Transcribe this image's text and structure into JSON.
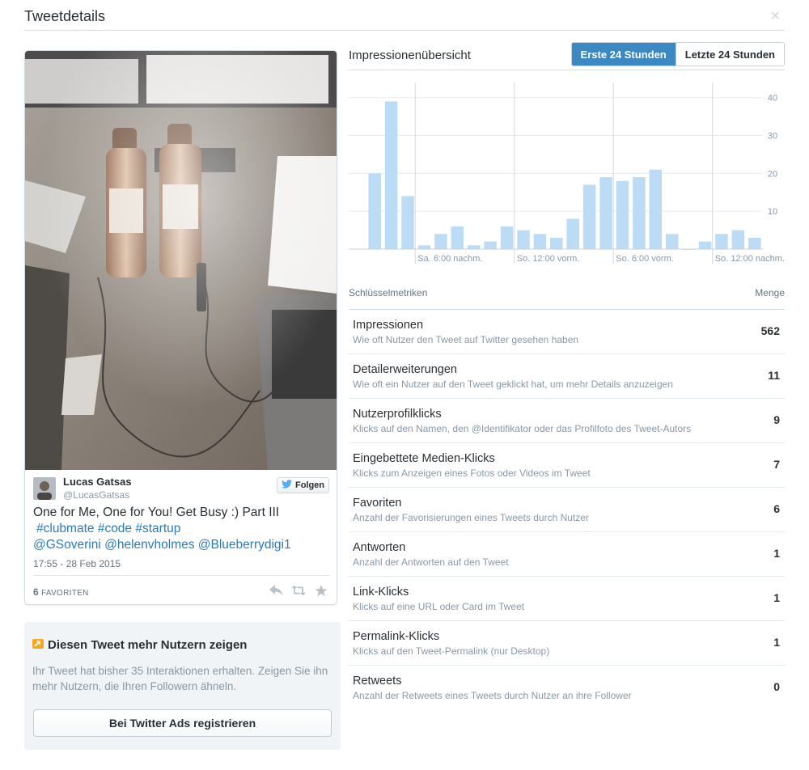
{
  "header": {
    "title": "Tweetdetails",
    "close_glyph": "×"
  },
  "tweet": {
    "author_name": "Lucas Gatsas",
    "author_handle": "@LucasGatsas",
    "follow_label": "Folgen",
    "text_plain": "One for Me, One for You! Get Busy :) Part III",
    "hashtags": "#clubmate #code #startup",
    "mentions": "@GSoverini @helenvholmes @Blueberrydigi1",
    "timestamp": "17:55 - 28 Feb 2015",
    "fav_count": "6",
    "fav_label": "FAVORITEN",
    "link_color": "#2b7bb9"
  },
  "promo": {
    "title": "Diesen Tweet mehr Nutzern zeigen",
    "text": "Ihr Tweet hat bisher 35 Interaktionen erhalten. Zeigen Sie ihn mehr Nutzern, die Ihren Followern ähneln.",
    "button_label": "Bei Twitter Ads registrieren"
  },
  "impressions": {
    "title": "Impressionenübersicht",
    "toggle": {
      "active": "Erste 24 Stunden",
      "inactive": "Letzte 24 Stunden"
    }
  },
  "chart_data": {
    "type": "bar",
    "title": "",
    "xlabel": "",
    "ylabel": "",
    "ylim": [
      0,
      44
    ],
    "yticks": [
      10,
      20,
      30,
      40
    ],
    "x_tick_labels": [
      "Sa. 6:00 nachm.",
      "So. 12:00 vorm.",
      "So. 6:00 vorm.",
      "So. 12:00 nachm."
    ],
    "bar_color": "#bcdcf5",
    "values": [
      20,
      39,
      14,
      1,
      4,
      6,
      1,
      2,
      6,
      5,
      4,
      3,
      8,
      17,
      19,
      18,
      19,
      21,
      4,
      0,
      2,
      4,
      5,
      3
    ]
  },
  "metrics": {
    "header_left": "Schlüsselmetriken",
    "header_right": "Menge",
    "rows": [
      {
        "name": "Impressionen",
        "desc": "Wie oft Nutzer den Tweet auf Twitter gesehen haben",
        "value": "562"
      },
      {
        "name": "Detailerweiterungen",
        "desc": "Wie oft ein Nutzer auf den Tweet geklickt hat, um mehr Details anzuzeigen",
        "value": "11"
      },
      {
        "name": "Nutzerprofilklicks",
        "desc": "Klicks auf den Namen, den @Identifikator oder das Profilfoto des Tweet-Autors",
        "value": "9"
      },
      {
        "name": "Eingebettete Medien-Klicks",
        "desc": "Klicks zum Anzeigen eines Fotos oder Videos im Tweet",
        "value": "7"
      },
      {
        "name": "Favoriten",
        "desc": "Anzahl der Favorisierungen eines Tweets durch Nutzer",
        "value": "6"
      },
      {
        "name": "Antworten",
        "desc": "Anzahl der Antworten auf den Tweet",
        "value": "1"
      },
      {
        "name": "Link-Klicks",
        "desc": "Klicks auf eine URL oder Card im Tweet",
        "value": "1"
      },
      {
        "name": "Permalink-Klicks",
        "desc": "Klicks auf den Tweet-Permalink (nur Desktop)",
        "value": "1"
      },
      {
        "name": "Retweets",
        "desc": "Anzahl der Retweets eines Tweets durch Nutzer an ihre Follower",
        "value": "0"
      }
    ]
  }
}
